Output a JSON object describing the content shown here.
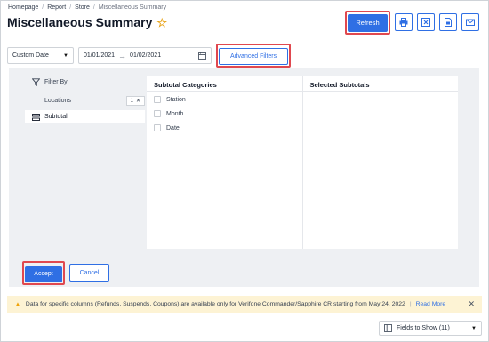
{
  "breadcrumb": [
    "Homepage",
    "Report",
    "Store",
    "Miscellaneous Summary"
  ],
  "page": {
    "title": "Miscellaneous Summary"
  },
  "toolbar": {
    "refresh_label": "Refresh",
    "icons": [
      "print-icon",
      "excel-export-icon",
      "pdf-export-icon",
      "email-icon"
    ]
  },
  "filters": {
    "date_mode": "Custom Date",
    "date_from": "01/01/2021",
    "date_to": "01/02/2021",
    "advanced_label": "Advanced Filters"
  },
  "sidebar": {
    "filter_by_label": "Filter By:",
    "locations_label": "Locations",
    "locations_count": "1",
    "subtotal_label": "Subtotal"
  },
  "subtotal_categories": {
    "header": "Subtotal Categories",
    "items": [
      "Station",
      "Month",
      "Date"
    ]
  },
  "selected_subtotals": {
    "header": "Selected Subtotals"
  },
  "actions": {
    "accept_label": "Accept",
    "cancel_label": "Cancel"
  },
  "notice": {
    "text": "Data for specific columns (Refunds, Suspends, Coupons) are available only for Verifone Commander/Sapphire CR starting from May 24, 2022",
    "separator": "|",
    "link": "Read More"
  },
  "fields_to_show": {
    "label": "Fields to Show (11)"
  },
  "colors": {
    "primary": "#2f6fe4",
    "highlight": "#e0484f",
    "star": "#e8a317",
    "notice_bg": "#fdf3d4"
  }
}
